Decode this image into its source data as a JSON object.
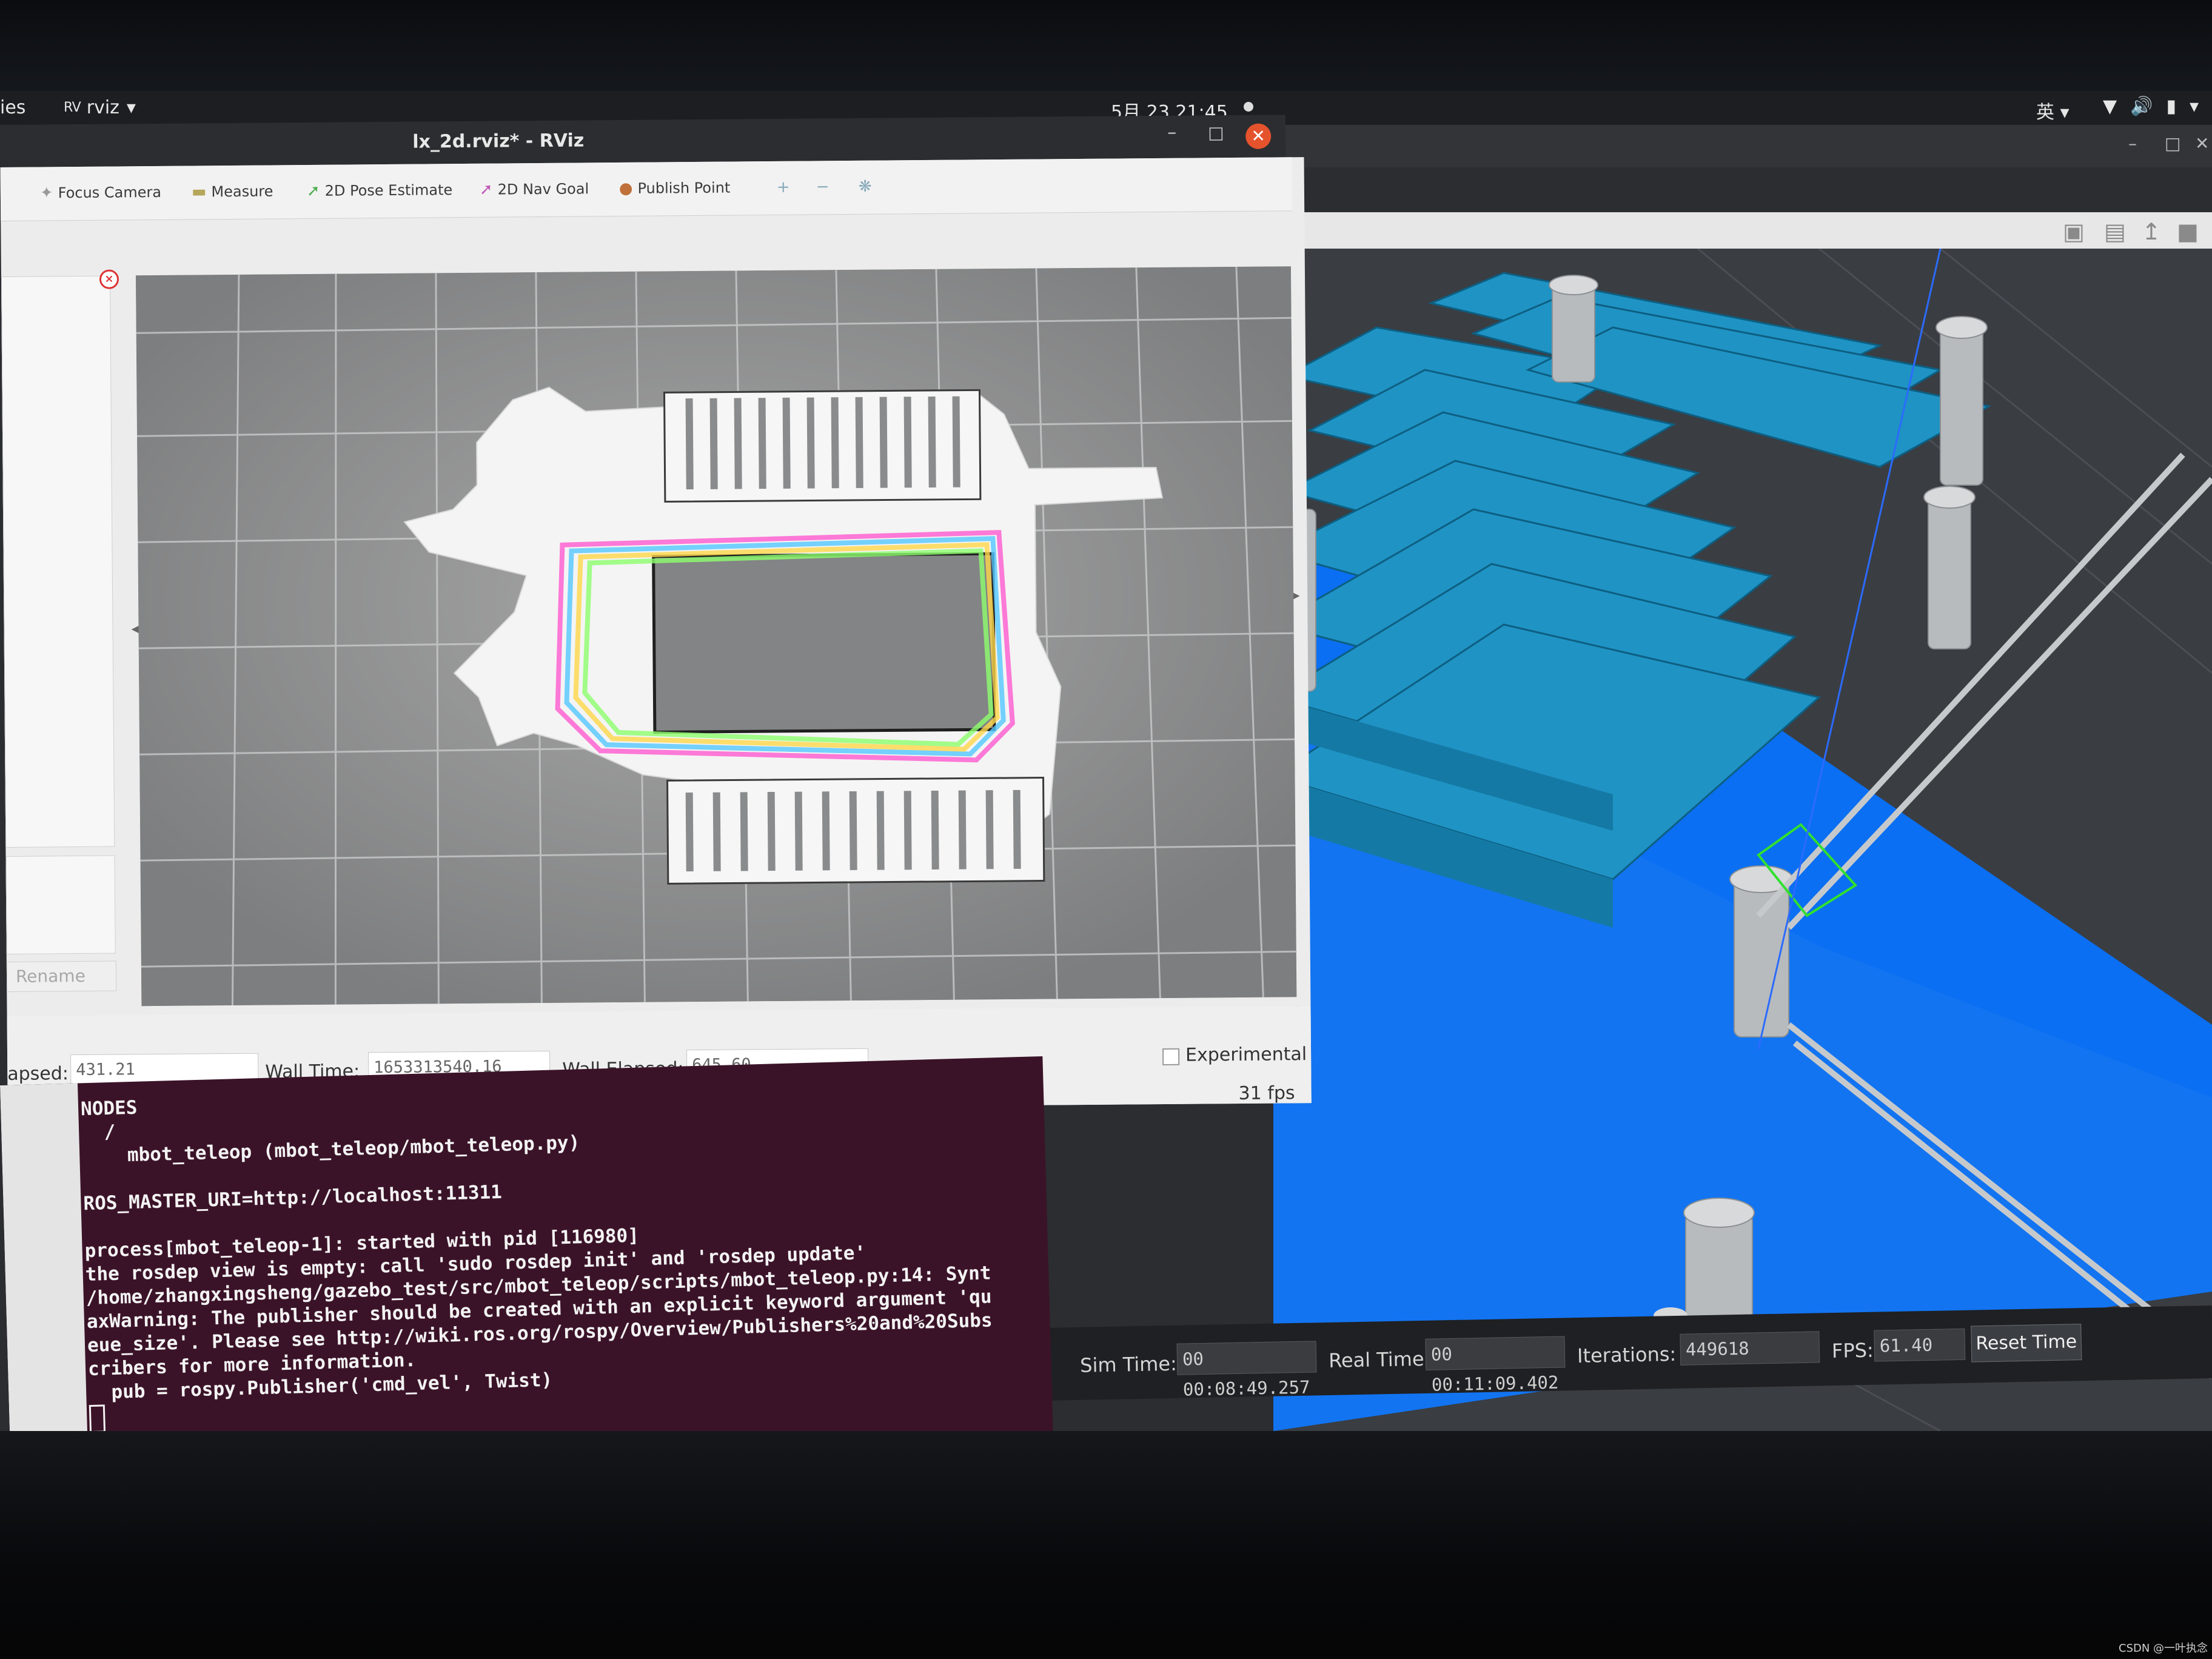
{
  "topbar": {
    "activities": "ies",
    "app_icon": "RViz-logo",
    "app_name": "rviz",
    "datetime": "5月 23 21:45",
    "ime": "英"
  },
  "rviz": {
    "title": "lx_2d.rviz* - RViz",
    "toolbar": [
      {
        "icon": "focus-camera-icon",
        "label": "Focus Camera"
      },
      {
        "icon": "measure-icon",
        "label": "Measure"
      },
      {
        "icon": "pose-estimate-icon",
        "label": "2D Pose Estimate"
      },
      {
        "icon": "nav-goal-icon",
        "label": "2D Nav Goal"
      },
      {
        "icon": "publish-point-icon",
        "label": "Publish Point"
      }
    ],
    "left_panel": {
      "rename_label": "Rename"
    },
    "time_panel": {
      "elapsed_label": "apsed:",
      "elapsed_value": "431.21",
      "wall_time_label": "Wall Time:",
      "wall_time_value": "1653313540.16",
      "wall_elapsed_label": "Wall Elapsed:",
      "wall_elapsed_value": "645.60",
      "experimental_label": "Experimental",
      "fps": "31 fps"
    }
  },
  "terminal": {
    "lines": [
      "NODES",
      "  /",
      "    mbot_teleop (mbot_teleop/mbot_teleop.py)",
      "",
      "ROS_MASTER_URI=http://localhost:11311",
      "",
      "process[mbot_teleop-1]: started with pid [116980]",
      "the rosdep view is empty: call 'sudo rosdep init' and 'rosdep update'",
      "/home/zhangxingsheng/gazebo_test/src/mbot_teleop/scripts/mbot_teleop.py:14: Synt",
      "axWarning: The publisher should be created with an explicit keyword argument 'qu",
      "eue_size'. Please see http://wiki.ros.org/rospy/Overview/Publishers%20and%20Subs",
      "cribers for more information.",
      "  pub = rospy.Publisher('cmd_vel', Twist)"
    ]
  },
  "gazebo": {
    "sim_time_label": "Sim Time:",
    "sim_time_value": "00 00:08:49.257",
    "real_time_label": "Real Time:",
    "real_time_value": "00 00:11:09.402",
    "iterations_label": "Iterations:",
    "iterations_value": "449618",
    "fps_label": "FPS:",
    "fps_value": "61.40",
    "reset_label": "Reset Time"
  },
  "watermark": "CSDN @一叶执念",
  "colors": {
    "shelf_blue": "#1f93c4",
    "floor_blue": "#0a6ff2",
    "terminal_bg": "#3b1328",
    "close_red": "#e5532d"
  }
}
